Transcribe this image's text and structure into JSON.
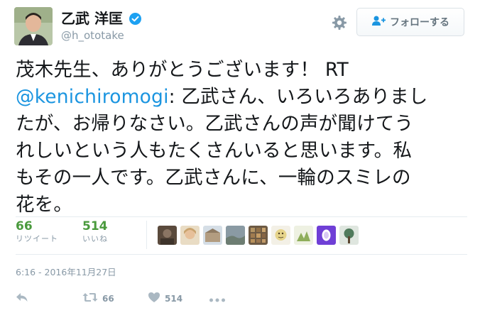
{
  "header": {
    "display_name": "乙武 洋匡",
    "handle": "@h_ototake",
    "follow_label": "フォローする"
  },
  "tweet": {
    "lines": [
      "茂木先生、ありがとうございます！ RT",
      ": 乙武さん、いろいろありまし",
      "たが、お帰りなさい。乙武さんの声が聞けてう",
      "れしいという人もたくさんいると思います。私",
      "もその一人です。乙武さんに、一輪のスミレの",
      "花を。"
    ],
    "mention": "@kenichiromogi"
  },
  "stats": {
    "retweets_count": "66",
    "retweets_label": "リツイート",
    "likes_count": "514",
    "likes_label": "いいね"
  },
  "timestamp": "6:16 - 2016年11月27日",
  "actions": {
    "retweet_count": "66",
    "like_count": "514"
  },
  "colors": {
    "link": "#1b95e0",
    "stat_count": "#4a9a3d",
    "muted": "#8899a6",
    "verified": "#1da1f2"
  }
}
